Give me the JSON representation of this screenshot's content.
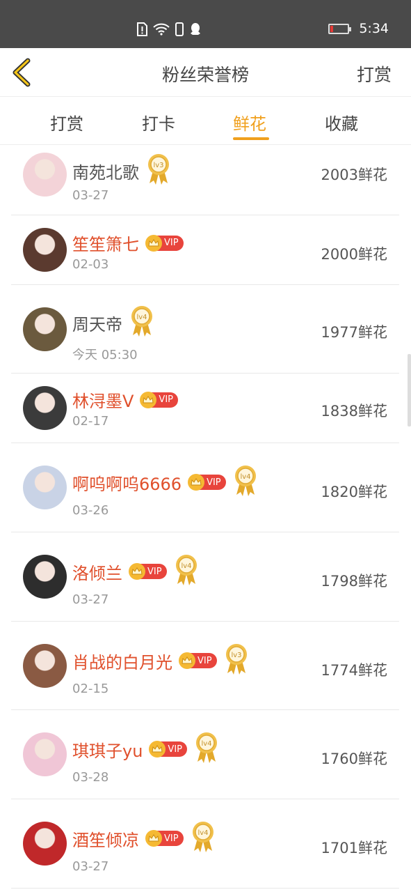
{
  "status_bar": {
    "time": "5:34"
  },
  "header": {
    "title": "粉丝荣誉榜",
    "action_label": "打赏"
  },
  "tabs": [
    {
      "label": "打赏",
      "active": false
    },
    {
      "label": "打卡",
      "active": false
    },
    {
      "label": "鲜花",
      "active": true
    },
    {
      "label": "收藏",
      "active": false
    }
  ],
  "accent_color": "#f0a01e",
  "vip_name_color": "#e0502c",
  "fans": [
    {
      "name": "南苑北歌",
      "date": "03-27",
      "flowers": "2003鲜花",
      "vip": false,
      "level": "lv3",
      "avatar_color": "#f3d3d8"
    },
    {
      "name": "笙笙箫七",
      "date": "02-03",
      "flowers": "2000鲜花",
      "vip": true,
      "vip_label": "VIP",
      "level": "",
      "avatar_color": "#5b3a2f"
    },
    {
      "name": "周天帝",
      "date": "今天 05:30",
      "flowers": "1977鲜花",
      "vip": false,
      "level": "lv4",
      "avatar_color": "#6b5a3e"
    },
    {
      "name": "林浔墨V",
      "date": "02-17",
      "flowers": "1838鲜花",
      "vip": true,
      "vip_label": "VIP",
      "level": "",
      "avatar_color": "#3b3b3b"
    },
    {
      "name": "啊呜啊呜6666",
      "date": "03-26",
      "flowers": "1820鲜花",
      "vip": true,
      "vip_label": "VIP",
      "level": "lv4",
      "avatar_color": "#c9d3e6"
    },
    {
      "name": "洛倾兰",
      "date": "03-27",
      "flowers": "1798鲜花",
      "vip": true,
      "vip_label": "VIP",
      "level": "lv4",
      "avatar_color": "#2d2d2d"
    },
    {
      "name": "肖战的白月光",
      "date": "02-15",
      "flowers": "1774鲜花",
      "vip": true,
      "vip_label": "VIP",
      "level": "lv3",
      "avatar_color": "#8a5a43"
    },
    {
      "name": "琪琪子yu",
      "date": "03-28",
      "flowers": "1760鲜花",
      "vip": true,
      "vip_label": "VIP",
      "level": "lv4",
      "avatar_color": "#f0c6d6"
    },
    {
      "name": "酒笙倾凉",
      "date": "03-27",
      "flowers": "1701鲜花",
      "vip": true,
      "vip_label": "VIP",
      "level": "lv4",
      "avatar_color": "#c0282a"
    }
  ]
}
